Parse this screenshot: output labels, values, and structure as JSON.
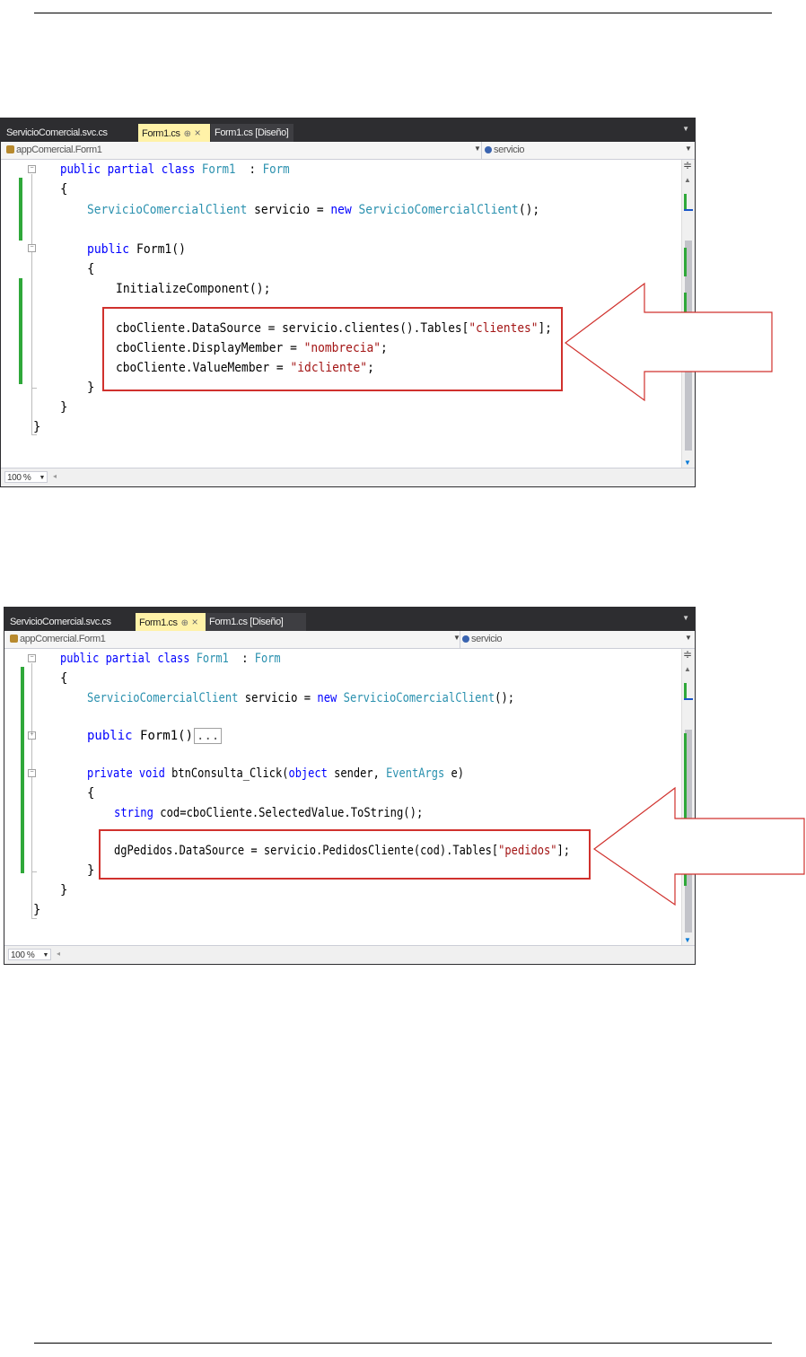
{
  "shot1": {
    "tabs": [
      {
        "label": "ServicioComercial.svc.cs"
      },
      {
        "label": "Form1.cs",
        "pin": "⊕",
        "close": "×"
      },
      {
        "label": "Form1.cs [Diseño]"
      }
    ],
    "nav_left": "appComercial.Form1",
    "nav_right": "servicio",
    "zoom": "100 %",
    "code": [
      {
        "p": [
          [
            "kw",
            "public partial class "
          ],
          [
            "ty",
            "Form1"
          ],
          [
            "",
            "  : "
          ],
          [
            "ty",
            "Form"
          ]
        ]
      },
      {
        "p": [
          [
            "",
            "{"
          ]
        ]
      },
      {
        "p": [
          [
            "ty",
            "ServicioComercialClient"
          ],
          [
            "",
            " servicio = "
          ],
          [
            "kw",
            "new "
          ],
          [
            "ty",
            "ServicioComercialClient"
          ],
          [
            "",
            "();"
          ]
        ]
      },
      {
        "p": [
          [
            "kw",
            "public "
          ],
          [
            "",
            "Form1()"
          ]
        ]
      },
      {
        "p": [
          [
            "",
            "{"
          ]
        ]
      },
      {
        "p": [
          [
            "",
            "InitializeComponent();"
          ]
        ]
      },
      {
        "p": [
          [
            "",
            "cboCliente.DataSource = servicio.clientes().Tables["
          ],
          [
            "st",
            "\"clientes\""
          ],
          [
            "",
            "];"
          ]
        ]
      },
      {
        "p": [
          [
            "",
            "cboCliente.DisplayMember = "
          ],
          [
            "st",
            "\"nombrecia\""
          ],
          [
            "",
            ";"
          ]
        ]
      },
      {
        "p": [
          [
            "",
            "cboCliente.ValueMember = "
          ],
          [
            "st",
            "\"idcliente\""
          ],
          [
            "",
            ";"
          ]
        ]
      },
      {
        "p": [
          [
            "",
            "}"
          ]
        ]
      },
      {
        "p": [
          [
            "",
            "}"
          ]
        ]
      },
      {
        "p": [
          [
            "",
            "}"
          ]
        ]
      }
    ]
  },
  "shot2": {
    "tabs": [
      {
        "label": "ServicioComercial.svc.cs"
      },
      {
        "label": "Form1.cs",
        "pin": "⊕",
        "close": "×"
      },
      {
        "label": "Form1.cs [Diseño]"
      }
    ],
    "nav_left": "appComercial.Form1",
    "nav_right": "servicio",
    "zoom": "100 %",
    "ellipsis": "...",
    "code": [
      {
        "p": [
          [
            "kw",
            "public partial class "
          ],
          [
            "ty",
            "Form1"
          ],
          [
            "",
            "  : "
          ],
          [
            "ty",
            "Form"
          ]
        ]
      },
      {
        "p": [
          [
            "",
            "{"
          ]
        ]
      },
      {
        "p": [
          [
            "ty",
            "ServicioComercialClient"
          ],
          [
            "",
            " servicio = "
          ],
          [
            "kw",
            "new "
          ],
          [
            "ty",
            "ServicioComercialClient"
          ],
          [
            "",
            "();"
          ]
        ]
      },
      {
        "p": [
          [
            "kw",
            "public "
          ],
          [
            "",
            "Form1()"
          ]
        ]
      },
      {
        "p": [
          [
            "kw",
            "private void "
          ],
          [
            "",
            "btnConsulta_Click("
          ],
          [
            "kw",
            "object"
          ],
          [
            "",
            " sender, "
          ],
          [
            "ty",
            "EventArgs"
          ],
          [
            "",
            " e)"
          ]
        ]
      },
      {
        "p": [
          [
            "",
            "{"
          ]
        ]
      },
      {
        "p": [
          [
            "kw",
            "string "
          ],
          [
            "",
            "cod=cboCliente.SelectedValue.ToString();"
          ]
        ]
      },
      {
        "p": [
          [
            "",
            "dgPedidos.DataSource = servicio.PedidosCliente(cod).Tables["
          ],
          [
            "st",
            "\"pedidos\""
          ],
          [
            "",
            "];"
          ]
        ]
      },
      {
        "p": [
          [
            "",
            "}"
          ]
        ]
      },
      {
        "p": [
          [
            "",
            "}"
          ]
        ]
      },
      {
        "p": [
          [
            "",
            "}"
          ]
        ]
      }
    ]
  },
  "colors": {
    "keyword": "#0000ff",
    "type": "#2b91af",
    "string": "#a31515",
    "highlight": "#d0312d",
    "change_bar": "#2fa83a"
  },
  "icons": [
    "class-nav-icon",
    "field-nav-icon",
    "fold-toggle-icon",
    "pin-tab-icon",
    "close-tab-icon",
    "callout-arrow-icon"
  ]
}
